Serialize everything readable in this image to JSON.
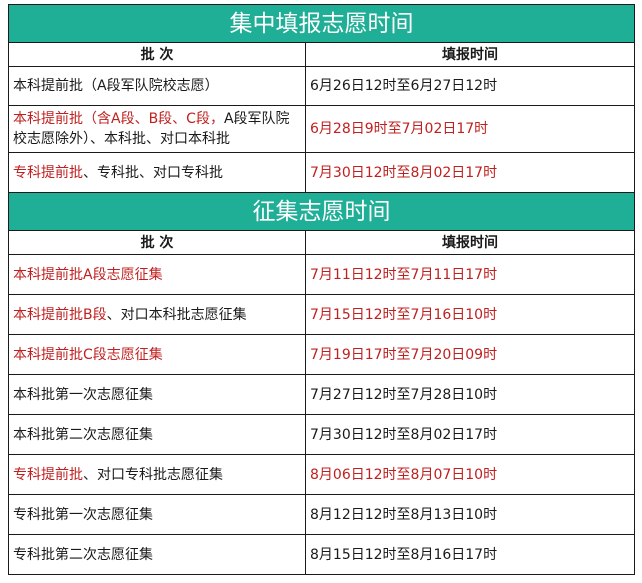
{
  "section1": {
    "title": "集中填报志愿时间",
    "header": {
      "batch": "批 次",
      "time": "填报时间"
    },
    "rows": [
      {
        "batch_parts": [
          {
            "text": "本科提前批（A段军队院校志愿）",
            "color": "black"
          }
        ],
        "time": "6月26日12时至6月27日12时",
        "time_color": "black"
      },
      {
        "batch_parts": [
          {
            "text": "本科提前批（含A段、B段、C段，",
            "color": "red"
          },
          {
            "text": "A段军队院校志愿除外）、本科批、对口本科批",
            "color": "black"
          }
        ],
        "time": "6月28日9时至7月02日17时",
        "time_color": "red"
      },
      {
        "batch_parts": [
          {
            "text": "专科提前批",
            "color": "red"
          },
          {
            "text": "、专科批、对口专科批",
            "color": "black"
          }
        ],
        "time": "7月30日12时至8月02日17时",
        "time_color": "red"
      }
    ]
  },
  "section2": {
    "title": "征集志愿时间",
    "header": {
      "batch": "批 次",
      "time": "填报时间"
    },
    "rows": [
      {
        "batch_parts": [
          {
            "text": "本科提前批A段志愿征集",
            "color": "red"
          }
        ],
        "time": "7月11日12时至7月11日17时",
        "time_color": "red"
      },
      {
        "batch_parts": [
          {
            "text": "本科提前批B段",
            "color": "red"
          },
          {
            "text": "、对口本科批志愿征集",
            "color": "black"
          }
        ],
        "time": "7月15日12时至7月16日10时",
        "time_color": "red"
      },
      {
        "batch_parts": [
          {
            "text": "本科提前批C段志愿征集",
            "color": "red"
          }
        ],
        "time": "7月19日17时至7月20日09时",
        "time_color": "red"
      },
      {
        "batch_parts": [
          {
            "text": "本科批第一次志愿征集",
            "color": "black"
          }
        ],
        "time": "7月27日12时至7月28日10时",
        "time_color": "black"
      },
      {
        "batch_parts": [
          {
            "text": "本科批第二次志愿征集",
            "color": "black"
          }
        ],
        "time": "7月30日12时至8月02日17时",
        "time_color": "black"
      },
      {
        "batch_parts": [
          {
            "text": "专科提前批",
            "color": "red"
          },
          {
            "text": "、对口专科批志愿征集",
            "color": "black"
          }
        ],
        "time": "8月06日12时至8月07日10时",
        "time_color": "red"
      },
      {
        "batch_parts": [
          {
            "text": "专科批第一次志愿征集",
            "color": "black"
          }
        ],
        "time": "8月12日12时至8月13日10时",
        "time_color": "black"
      },
      {
        "batch_parts": [
          {
            "text": "专科批第二次志愿征集",
            "color": "black"
          }
        ],
        "time": "8月15日12时至8月16日17时",
        "time_color": "black"
      }
    ]
  },
  "colors": {
    "header_bg": "#1fae96",
    "header_text": "#ffffff",
    "red": "#c0201f",
    "black": "#1a1a1a",
    "border": "#1a1a1a"
  }
}
